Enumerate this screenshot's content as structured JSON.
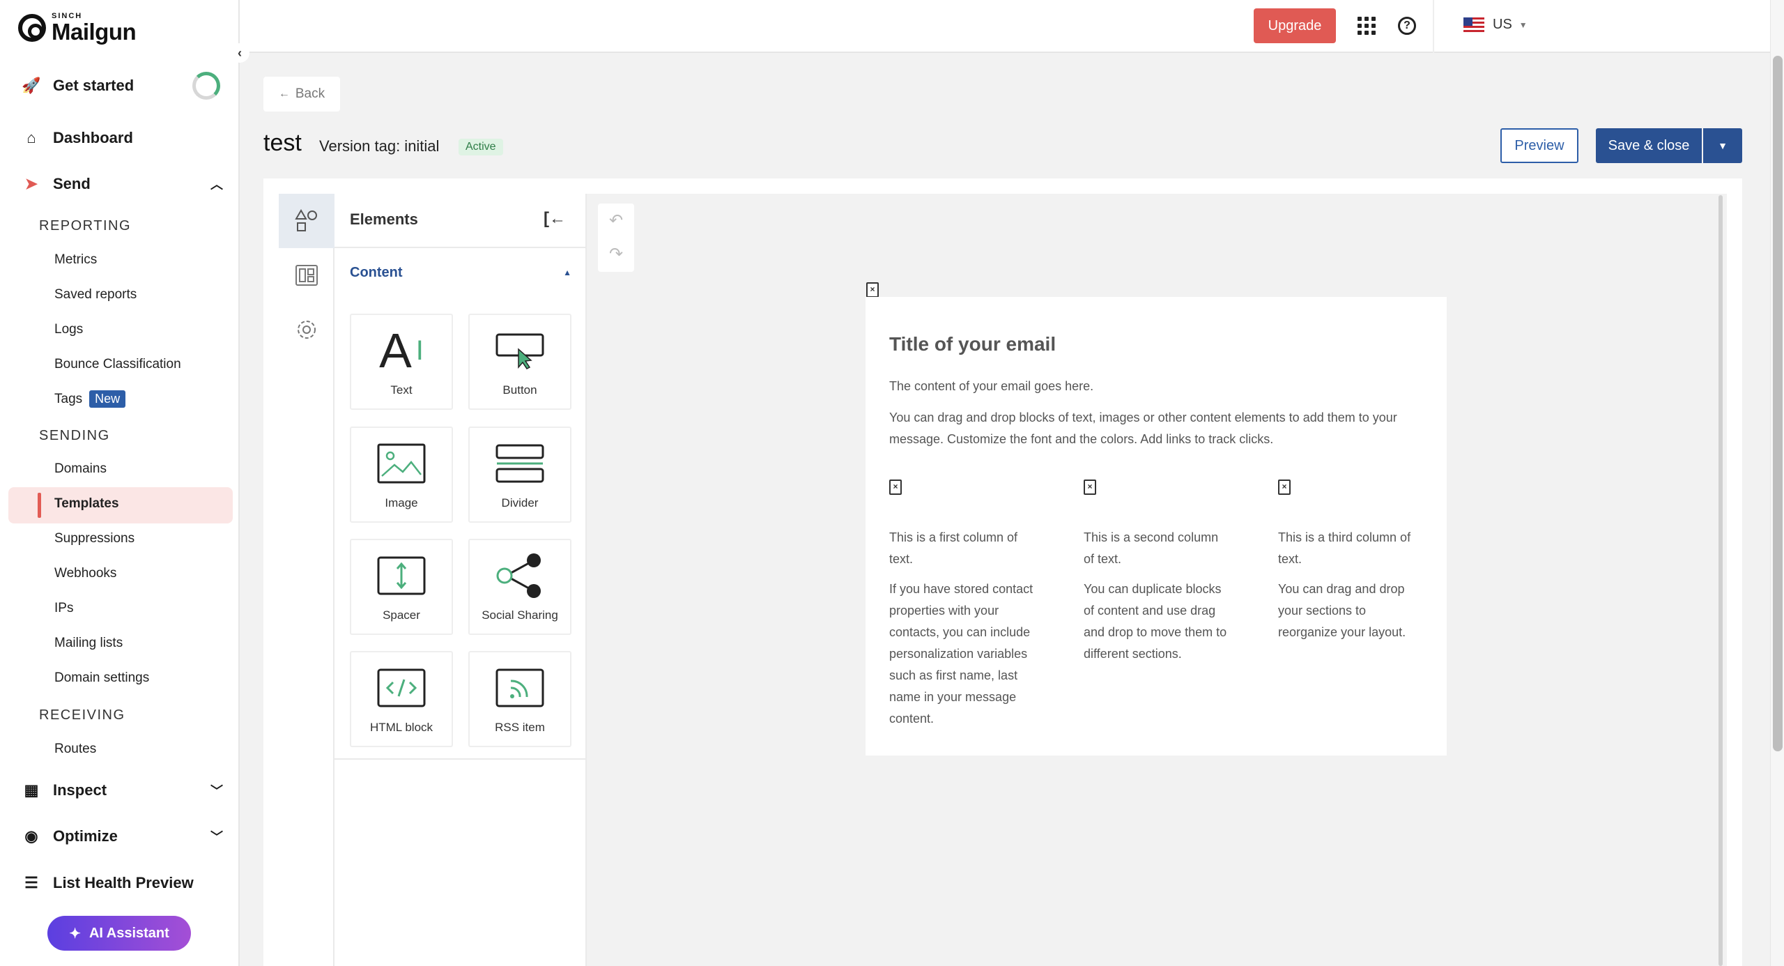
{
  "brand": {
    "small": "SINCH",
    "name": "Mailgun"
  },
  "sidebar": {
    "get_started": "Get started",
    "dashboard": "Dashboard",
    "send": "Send",
    "reporting_label": "REPORTING",
    "reporting_items": [
      "Metrics",
      "Saved reports",
      "Logs",
      "Bounce Classification",
      "Tags"
    ],
    "tags_badge": "New",
    "sending_label": "SENDING",
    "sending_items": [
      "Domains",
      "Templates",
      "Suppressions",
      "Webhooks",
      "IPs",
      "Mailing lists",
      "Domain settings"
    ],
    "receiving_label": "RECEIVING",
    "receiving_items": [
      "Routes"
    ],
    "inspect": "Inspect",
    "optimize": "Optimize",
    "list_health": "List Health Preview",
    "ai_assistant": "AI Assistant",
    "active_item": "Templates"
  },
  "topbar": {
    "upgrade": "Upgrade",
    "region": "US"
  },
  "header": {
    "back": "Back",
    "title": "test",
    "version_tag": "Version tag: initial",
    "status": "Active",
    "preview": "Preview",
    "save_close": "Save & close"
  },
  "panel": {
    "title": "Elements",
    "section": "Content",
    "tiles": [
      {
        "label": "Text",
        "icon": "text-icon"
      },
      {
        "label": "Button",
        "icon": "button-icon"
      },
      {
        "label": "Image",
        "icon": "image-icon"
      },
      {
        "label": "Divider",
        "icon": "divider-icon"
      },
      {
        "label": "Spacer",
        "icon": "spacer-icon"
      },
      {
        "label": "Social Sharing",
        "icon": "share-icon"
      },
      {
        "label": "HTML block",
        "icon": "code-icon"
      },
      {
        "label": "RSS item",
        "icon": "rss-icon"
      }
    ]
  },
  "email": {
    "title": "Title of your email",
    "p1": "The content of your email goes here.",
    "p2": "You can drag and drop blocks of text, images or other content elements to add them to your message. Customize the font and the colors. Add links to track clicks.",
    "col1_a": "This is a first column of text.",
    "col1_b": "If you have stored contact properties with your contacts, you can include personalization variables such as first name, last name in your message content.",
    "col2_a": "This is a second column of text.",
    "col2_b": "You can duplicate blocks of content and use drag and drop to move them to different sections.",
    "col3_a": "This is a third column of text.",
    "col3_b": "You can drag and drop your sections to reorganize your layout."
  },
  "colors": {
    "accent": "#e05a54",
    "primary": "#2a5192",
    "active_bg": "#fbe6e5",
    "badge_green": "#dff3e4"
  }
}
